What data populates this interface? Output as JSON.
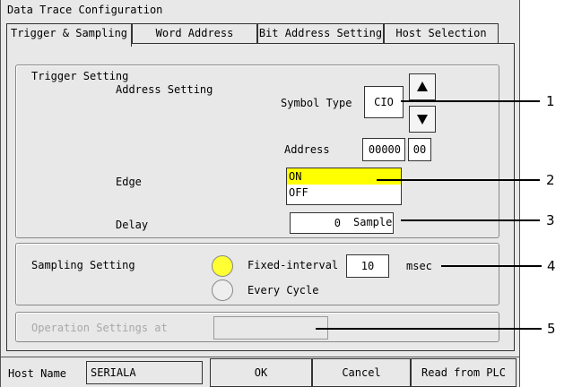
{
  "window": {
    "title": "Data Trace Configuration"
  },
  "tabs": [
    {
      "label": "Trigger & Sampling"
    },
    {
      "label": "Word Address"
    },
    {
      "label": "Bit Address Setting"
    },
    {
      "label": "Host Selection"
    }
  ],
  "trigger": {
    "group_label": "Trigger Setting",
    "address_setting_label": "Address Setting",
    "symbol_type_label": "Symbol Type",
    "symbol_type_value": "CIO",
    "address_label": "Address",
    "address_value": "00000",
    "bit_value": "00",
    "edge_label": "Edge",
    "edge_options": [
      "ON",
      "OFF"
    ],
    "delay_label": "Delay",
    "delay_value": "0",
    "delay_unit": "Sample"
  },
  "sampling": {
    "group_label": "Sampling Setting",
    "fixed_label": "Fixed-interval",
    "fixed_value": "10",
    "fixed_unit": "msec",
    "every_cycle_label": "Every Cycle"
  },
  "operation": {
    "label": "Operation Settings at",
    "value": ""
  },
  "bottom": {
    "host_name_label": "Host Name",
    "host_name_value": "SERIALA",
    "ok_label": "OK",
    "cancel_label": "Cancel",
    "read_label": "Read from PLC"
  },
  "callouts": [
    "1",
    "2",
    "3",
    "4",
    "5"
  ],
  "colors": {
    "highlight": "#ffff00",
    "radio_selected": "#ffff33"
  }
}
